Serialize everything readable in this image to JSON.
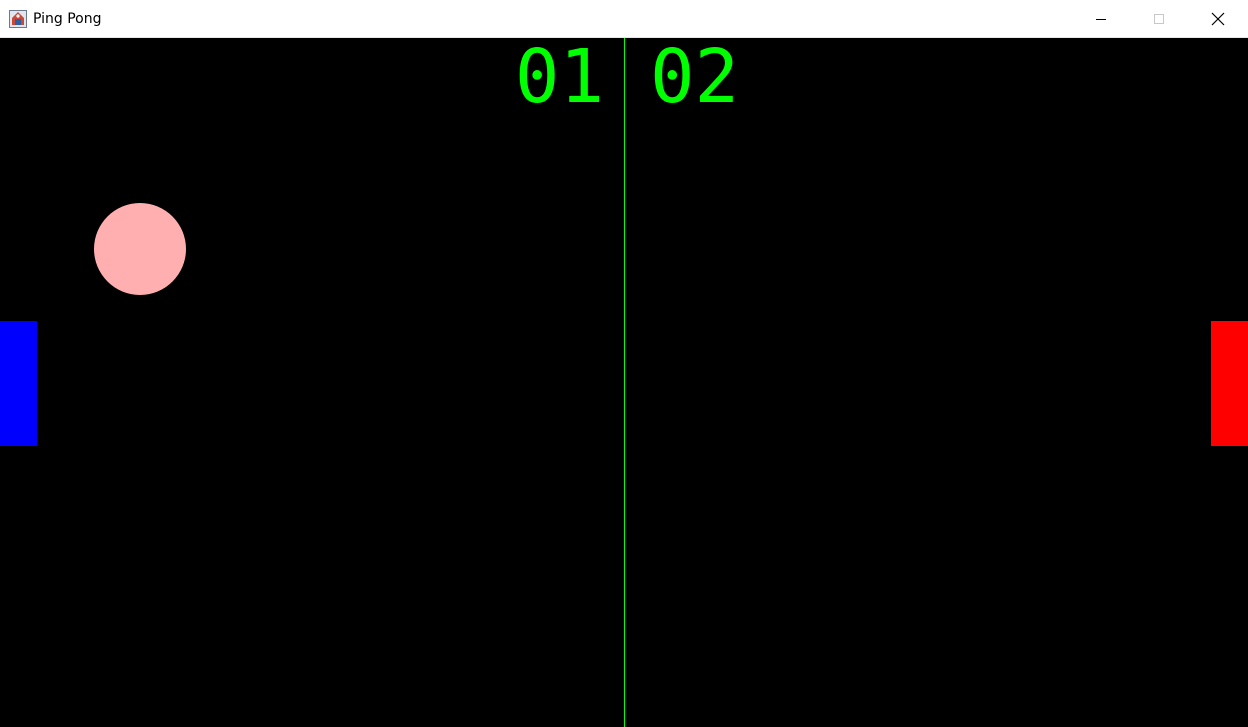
{
  "window": {
    "title": "Ping Pong",
    "icons": {
      "app": "java-app-icon",
      "minimize": "minimize-icon",
      "maximize": "maximize-icon",
      "close": "close-icon"
    }
  },
  "game": {
    "score": {
      "left": "01",
      "right": "02"
    },
    "colors": {
      "background": "#000000",
      "score": "#00ff00",
      "center_line": "#00ff00",
      "ball": "#ffafaf",
      "left_paddle": "#0000ff",
      "right_paddle": "#ff0000"
    }
  }
}
